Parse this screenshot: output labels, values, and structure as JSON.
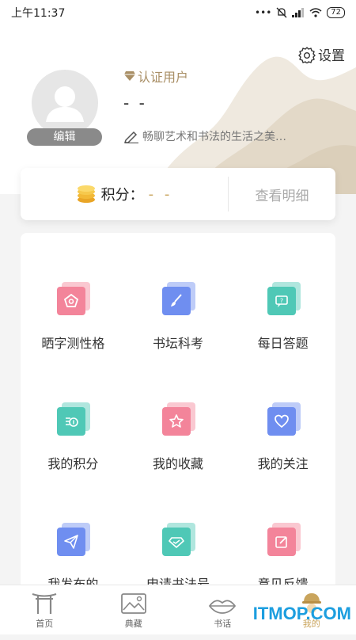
{
  "status": {
    "time": "上午11:37",
    "signal_dots": "•••",
    "battery": "72"
  },
  "header": {
    "settings_label": "设置",
    "edit_avatar_label": "编辑",
    "verified_label": "认证用户",
    "username": "- -",
    "bio": "畅聊艺术和书法的生活之美…"
  },
  "points": {
    "label": "积分：",
    "value": "- -",
    "detail_label": "查看明细"
  },
  "menu": {
    "items": [
      {
        "label": "晒字测性格",
        "icon": "pentagon-icon",
        "color": "#f3849a"
      },
      {
        "label": "书坛科考",
        "icon": "brush-icon",
        "color": "#6f8ef0"
      },
      {
        "label": "每日答题",
        "icon": "question-chat-icon",
        "color": "#4fc8b6"
      },
      {
        "label": "我的积分",
        "icon": "coins-icon",
        "color": "#4fc8b6"
      },
      {
        "label": "我的收藏",
        "icon": "star-icon",
        "color": "#f3849a"
      },
      {
        "label": "我的关注",
        "icon": "heart-icon",
        "color": "#6f8ef0"
      },
      {
        "label": "我发布的",
        "icon": "paper-plane-icon",
        "color": "#6f8ef0"
      },
      {
        "label": "申请书法号",
        "icon": "diamond-icon",
        "color": "#4fc8b6"
      },
      {
        "label": "意见反馈",
        "icon": "edit-note-icon",
        "color": "#f3849a"
      }
    ]
  },
  "tabbar": {
    "items": [
      {
        "label": "首页",
        "icon": "gate-icon"
      },
      {
        "label": "典藏",
        "icon": "picture-icon"
      },
      {
        "label": "书话",
        "icon": "lips-icon"
      },
      {
        "label": "我的",
        "icon": "user-hat-icon"
      }
    ],
    "active_color": "#c9a45c"
  },
  "watermark": "ITMOP.COM"
}
